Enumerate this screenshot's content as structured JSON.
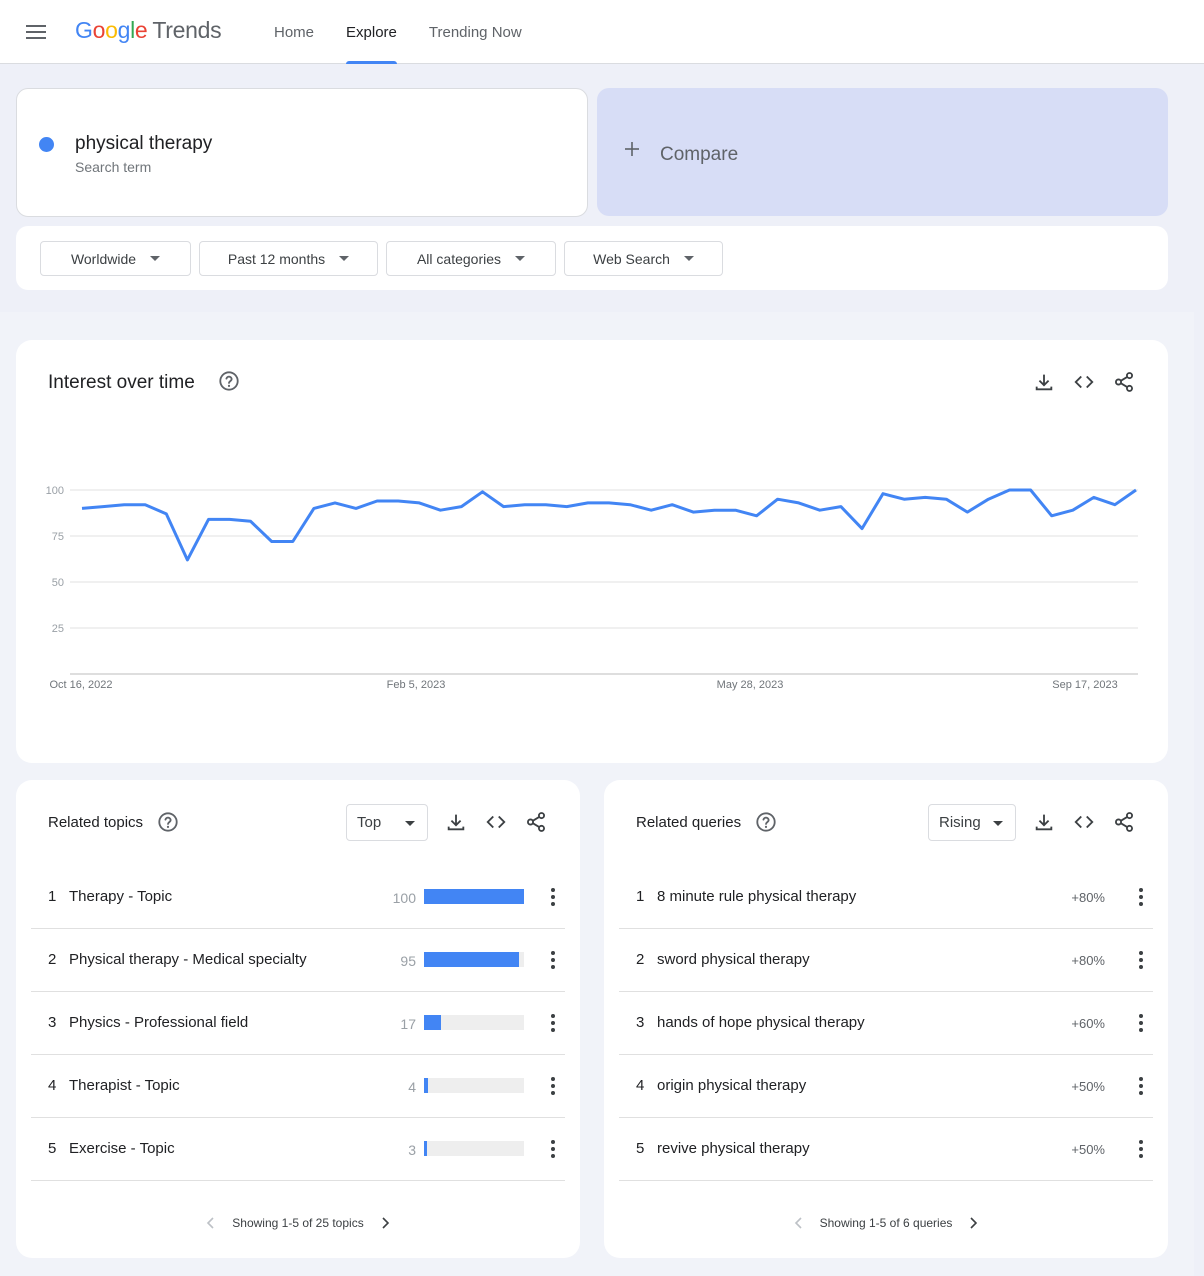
{
  "header": {
    "logo_google": [
      "G",
      "o",
      "o",
      "g",
      "l",
      "e"
    ],
    "logo_google_colors": [
      "#4285f4",
      "#ea4335",
      "#fbbc05",
      "#4285f4",
      "#34a853",
      "#ea4335"
    ],
    "logo_trends": "Trends",
    "tabs": [
      {
        "label": "Home",
        "active": false
      },
      {
        "label": "Explore",
        "active": true
      },
      {
        "label": "Trending Now",
        "active": false
      }
    ]
  },
  "search": {
    "term": "physical therapy",
    "term_type": "Search term",
    "term_color": "#4285f4",
    "compare_label": "Compare"
  },
  "filters": {
    "region": "Worldwide",
    "time_range": "Past 12 months",
    "category": "All categories",
    "search_type": "Web Search"
  },
  "interest_over_time": {
    "title": "Interest over time",
    "chart_data": {
      "type": "line",
      "x_tick_labels": [
        "Oct 16, 2022",
        "Feb 5, 2023",
        "May 28, 2023",
        "Sep 17, 2023"
      ],
      "y_ticks": [
        25,
        50,
        75,
        100
      ],
      "ylim": [
        0,
        100
      ],
      "grid": true,
      "series": [
        {
          "color": "#4285f4",
          "values": [
            90,
            91,
            92,
            92,
            87,
            62,
            84,
            84,
            83,
            72,
            72,
            90,
            93,
            90,
            94,
            94,
            93,
            89,
            91,
            99,
            91,
            92,
            92,
            91,
            93,
            93,
            92,
            89,
            92,
            88,
            89,
            89,
            86,
            95,
            93,
            89,
            91,
            79,
            98,
            95,
            96,
            95,
            88,
            95,
            100,
            100,
            86,
            89,
            96,
            92,
            100
          ]
        }
      ]
    }
  },
  "related_topics": {
    "title": "Related topics",
    "filter": "Top",
    "items": [
      {
        "rank": "1",
        "label": "Therapy - Topic",
        "value": "100",
        "score": 100
      },
      {
        "rank": "2",
        "label": "Physical therapy - Medical specialty",
        "value": "95",
        "score": 95
      },
      {
        "rank": "3",
        "label": "Physics - Professional field",
        "value": "17",
        "score": 17
      },
      {
        "rank": "4",
        "label": "Therapist - Topic",
        "value": "4",
        "score": 4
      },
      {
        "rank": "5",
        "label": "Exercise - Topic",
        "value": "3",
        "score": 3
      }
    ],
    "pagination": "Showing 1-5 of 25 topics"
  },
  "related_queries": {
    "title": "Related queries",
    "filter": "Rising",
    "items": [
      {
        "rank": "1",
        "label": "8 minute rule physical therapy",
        "value": "+80%"
      },
      {
        "rank": "2",
        "label": "sword physical therapy",
        "value": "+80%"
      },
      {
        "rank": "3",
        "label": "hands of hope physical therapy",
        "value": "+60%"
      },
      {
        "rank": "4",
        "label": "origin physical therapy",
        "value": "+50%"
      },
      {
        "rank": "5",
        "label": "revive physical therapy",
        "value": "+50%"
      }
    ],
    "pagination": "Showing 1-5 of 6 queries"
  }
}
